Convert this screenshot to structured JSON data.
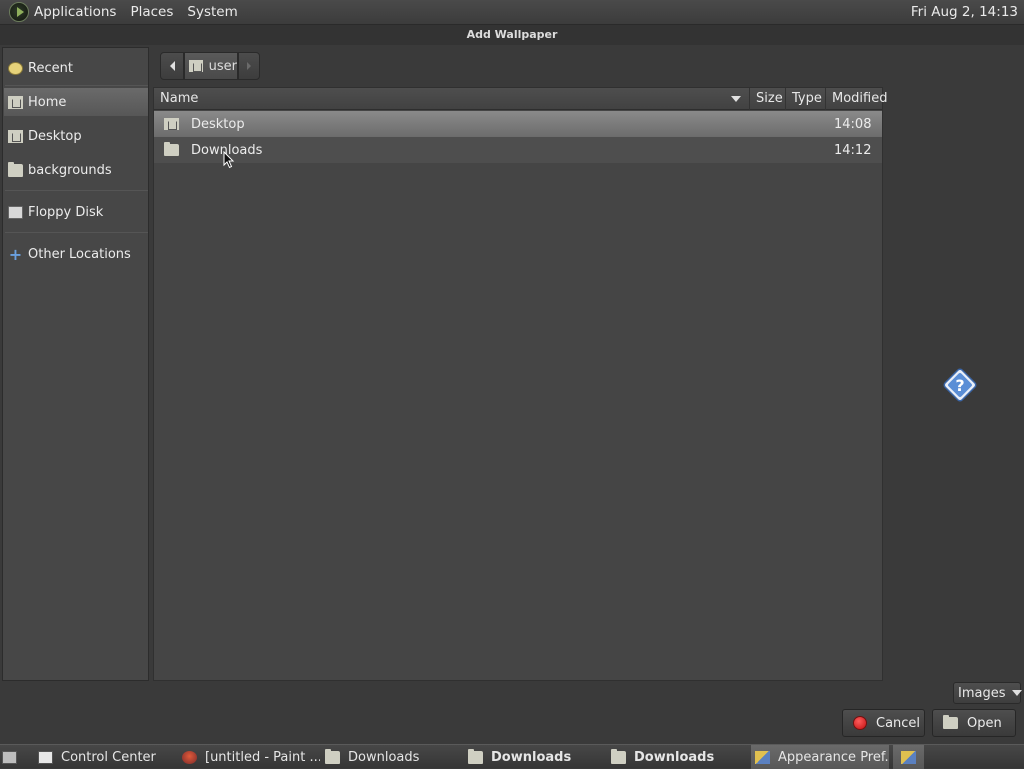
{
  "top_panel": {
    "menus": [
      "Applications",
      "Places",
      "System"
    ],
    "clock": "Fri Aug  2, 14:13"
  },
  "window": {
    "title": "Add Wallpaper"
  },
  "sidebar": {
    "items": [
      {
        "label": "Recent",
        "icon": "recent-icon"
      },
      {
        "label": "Home",
        "icon": "home-icon",
        "selected": true
      },
      {
        "label": "Desktop",
        "icon": "desktop-folder-icon"
      },
      {
        "label": "backgrounds",
        "icon": "folder-icon"
      },
      {
        "label": "Floppy Disk",
        "icon": "floppy-disk-icon"
      },
      {
        "label": "Other Locations",
        "icon": "plus-icon"
      }
    ]
  },
  "pathbar": {
    "current": "user"
  },
  "file_list": {
    "columns": [
      "Name",
      "Size",
      "Type",
      "Modified"
    ],
    "rows": [
      {
        "name": "Desktop",
        "size": "",
        "type": "",
        "modified": "14:08",
        "selected": true
      },
      {
        "name": "Downloads",
        "size": "",
        "type": "",
        "modified": "14:12",
        "selected": false
      }
    ]
  },
  "filter": {
    "selected": "Images"
  },
  "buttons": {
    "cancel": "Cancel",
    "open": "Open"
  },
  "taskbar": {
    "items": [
      {
        "label": "Control Center",
        "icon": "control-center-icon"
      },
      {
        "label": "[untitled - Paint ...",
        "icon": "paint-icon"
      },
      {
        "label": "Downloads",
        "icon": "folder-icon"
      },
      {
        "label": "Downloads",
        "icon": "folder-icon",
        "bold": true
      },
      {
        "label": "Downloads",
        "icon": "folder-icon",
        "bold": true
      },
      {
        "label": "Appearance Pref...",
        "icon": "appearance-icon",
        "active": true
      }
    ]
  },
  "colors": {
    "background": "#3a3a3a",
    "selection": "#7a7a7a",
    "cancel_red": "#d01818",
    "help_blue": "#5a8ed6"
  }
}
